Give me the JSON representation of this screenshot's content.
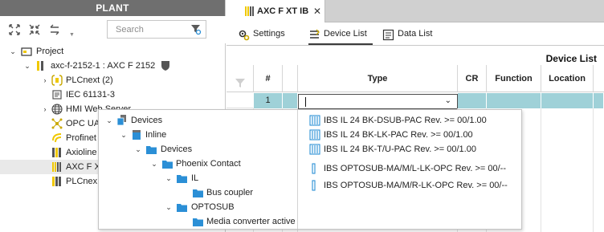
{
  "plant": {
    "header": "PLANT",
    "search_placeholder": "Search",
    "toolbar_icons": [
      "expand-all-icon",
      "collapse-all-icon",
      "swap-icon"
    ],
    "tree": [
      {
        "label": "Project",
        "icon": "project-icon",
        "expanded": true
      },
      {
        "label": "axc-f-2152-1 : AXC F 2152",
        "icon": "controller-icon",
        "expanded": true
      },
      {
        "label": "PLCnext (2)",
        "icon": "plcnext-icon",
        "expanded": false
      },
      {
        "label": "IEC 61131-3",
        "icon": "iec-icon"
      },
      {
        "label": "HMI Web Server",
        "icon": "globe-icon",
        "expanded": false
      },
      {
        "label": "OPC UA",
        "icon": "opc-icon"
      },
      {
        "label": "Profinet",
        "icon": "profinet-icon"
      },
      {
        "label": "Axioline",
        "icon": "axioline-icon"
      },
      {
        "label": "AXC F X",
        "icon": "axc-icon",
        "selected": true
      },
      {
        "label": "PLCnex",
        "icon": "plcnext-module-icon"
      }
    ]
  },
  "editor": {
    "tab_label": "AXC F XT IB",
    "close_glyph": "✕",
    "subtabs": [
      {
        "label": "Settings",
        "icon": "settings-icon"
      },
      {
        "label": "Device List",
        "icon": "device-list-icon",
        "active": true
      },
      {
        "label": "Data List",
        "icon": "data-list-icon"
      }
    ],
    "device_list_title": "Device List",
    "columns": [
      "#",
      "Type",
      "CR",
      "Function",
      "Location"
    ],
    "rows": [
      {
        "index": "1",
        "type": ""
      }
    ]
  },
  "popup": {
    "tree": [
      {
        "label": "Devices",
        "level": 0,
        "icon": "devices-root-icon",
        "expanded": true
      },
      {
        "label": "Inline",
        "level": 1,
        "icon": "inline-icon",
        "expanded": true
      },
      {
        "label": "Devices",
        "level": 2,
        "icon": "folder-icon",
        "expanded": true
      },
      {
        "label": "Phoenix Contact",
        "level": 3,
        "icon": "folder-icon",
        "expanded": true
      },
      {
        "label": "IL",
        "level": 4,
        "icon": "folder-icon",
        "expanded": true
      },
      {
        "label": "Bus coupler",
        "level": 5,
        "icon": "folder-icon"
      },
      {
        "label": "OPTOSUB",
        "level": 4,
        "icon": "folder-icon",
        "expanded": true
      },
      {
        "label": "Media converter active",
        "level": 5,
        "icon": "folder-icon"
      }
    ],
    "items": [
      {
        "label": "IBS IL 24 BK-DSUB-PAC Rev. >= 00/1.00",
        "icon": "io-module-icon"
      },
      {
        "label": "IBS IL 24 BK-LK-PAC Rev. >= 00/1.00",
        "icon": "io-module-icon"
      },
      {
        "label": "IBS IL 24 BK-T/U-PAC Rev. >= 00/1.00",
        "icon": "io-module-icon"
      },
      {
        "label": "IBS OPTOSUB-MA/M/L-LK-OPC Rev. >= 00/--",
        "icon": "slim-module-icon"
      },
      {
        "label": "IBS OPTOSUB-MA/M/R-LK-OPC Rev. >= 00/--",
        "icon": "slim-module-icon"
      }
    ]
  },
  "colors": {
    "header_gray": "#6f6f6f",
    "selected_row": "#9fd1d8",
    "folder_blue": "#2b8fd6",
    "accent_yellow": "#f0c800"
  }
}
